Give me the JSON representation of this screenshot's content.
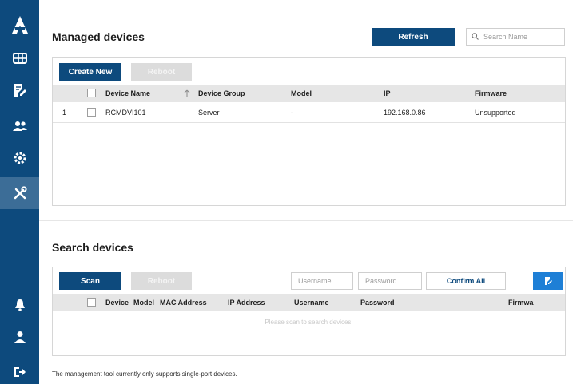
{
  "sidebar": {
    "items": [
      {
        "icon": "logo-icon"
      },
      {
        "icon": "dashboard-icon"
      },
      {
        "icon": "edit-document-icon"
      },
      {
        "icon": "users-icon"
      },
      {
        "icon": "settings-icon"
      },
      {
        "icon": "tools-icon",
        "active": true
      },
      {
        "icon": "notification-bell-icon"
      },
      {
        "icon": "user-icon"
      },
      {
        "icon": "logout-icon"
      }
    ]
  },
  "managed": {
    "title": "Managed devices",
    "refresh_label": "Refresh",
    "search_placeholder": "Search Name",
    "create_label": "Create New",
    "reboot_label": "Reboot",
    "columns": [
      "Device Name",
      "Device Group",
      "Model",
      "IP",
      "Firmware"
    ],
    "rows": [
      {
        "index": "1",
        "name": "RCMDVI101",
        "group": "Server",
        "model": "-",
        "ip": "192.168.0.86",
        "firmware": "Unsupported"
      }
    ]
  },
  "search": {
    "title": "Search devices",
    "scan_label": "Scan",
    "reboot_label": "Reboot",
    "username_placeholder": "Username",
    "password_placeholder": "Password",
    "confirm_label": "Confirm All",
    "columns": [
      "Device",
      "Model",
      "MAC Address",
      "IP Address",
      "Username",
      "Password",
      "Firmwa"
    ],
    "empty_text": "Please scan to search devices."
  },
  "footer_note": "The management tool currently only supports single-port devices.",
  "colors": {
    "primary": "#0d4a7d",
    "accent": "#1e7fd6",
    "active_nav": "#3c6d97"
  }
}
